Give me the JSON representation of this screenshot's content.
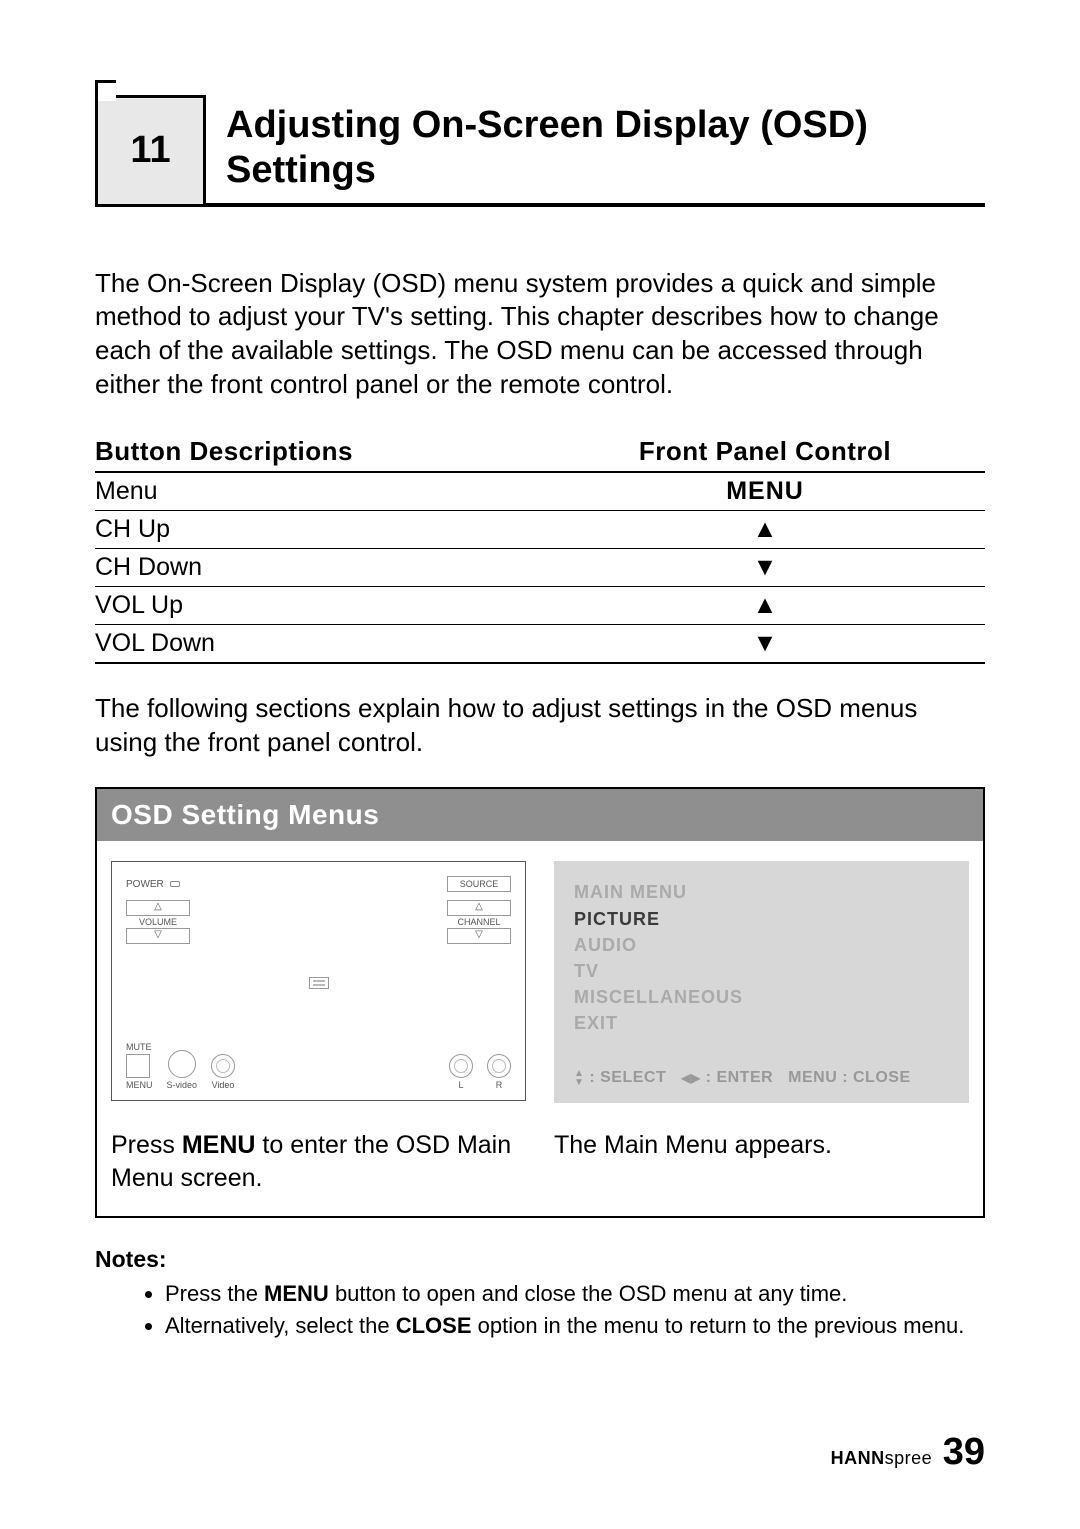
{
  "chapter": {
    "number": "11",
    "title": "Adjusting On-Screen Display (OSD) Settings"
  },
  "intro": "The On-Screen Display (OSD) menu system provides a quick and simple method to adjust your TV's setting. This chapter describes how to change each of the available settings. The OSD menu can be accessed through either the front control panel or the remote control.",
  "table": {
    "headers": {
      "left": "Button Descriptions",
      "right": "Front Panel Control"
    },
    "rows": [
      {
        "desc": "Menu",
        "control": "MENU",
        "type": "text"
      },
      {
        "desc": "CH Up",
        "control": "▲",
        "type": "icon"
      },
      {
        "desc": "CH Down",
        "control": "▼",
        "type": "icon"
      },
      {
        "desc": "VOL Up",
        "control": "▲",
        "type": "icon"
      },
      {
        "desc": "VOL Down",
        "control": "▼",
        "type": "icon"
      }
    ]
  },
  "following": "The following sections explain how to adjust settings in the OSD menus using the front panel control.",
  "osd_box": {
    "header_left": "OSD Setting Menus",
    "header_right": "",
    "panel": {
      "power": "POWER",
      "source": "SOURCE",
      "volume": "VOLUME",
      "channel": "CHANNEL",
      "mute": "MUTE",
      "menu": "MENU",
      "svideo": "S-video",
      "video": "Video",
      "l": "L",
      "r": "R"
    },
    "screen": {
      "title": "MAIN MENU",
      "items": [
        "PICTURE",
        "AUDIO",
        "TV",
        "MISCELLANEOUS",
        "EXIT"
      ],
      "selected_index": 0,
      "hint_select": ": SELECT",
      "hint_enter": ": ENTER",
      "hint_close": "MENU : CLOSE"
    },
    "caption_left_pre": "Press ",
    "caption_left_bold": "MENU",
    "caption_left_post": " to enter the OSD Main Menu screen.",
    "caption_right": "The Main Menu appears."
  },
  "notes": {
    "title": "Notes:",
    "items": [
      {
        "pre": "Press the ",
        "bold": "MENU",
        "post": " button to open and close the OSD menu at any time."
      },
      {
        "pre": "Alternatively, select the ",
        "bold": "CLOSE",
        "post": " option in the menu to return to the previous menu."
      }
    ]
  },
  "footer": {
    "brand_bold": "HANN",
    "brand_light": "spree",
    "page": "39"
  }
}
